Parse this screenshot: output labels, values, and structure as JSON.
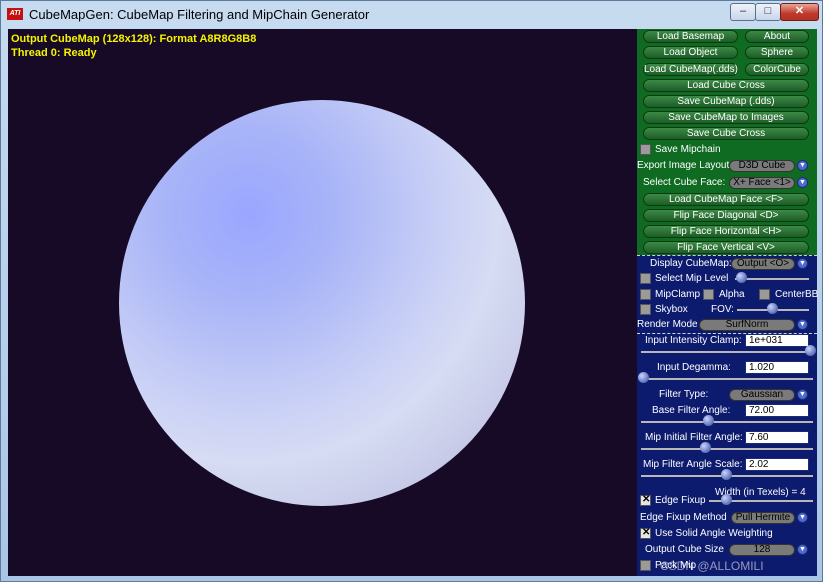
{
  "window": {
    "title": "CubeMapGen: CubeMap Filtering and MipChain Generator",
    "icon_text": "ATI",
    "min": "–",
    "max": "□",
    "close": "✕"
  },
  "viewport": {
    "line1": "Output CubeMap (128x128): Format A8R8G8B8",
    "line2": "Thread 0: Ready"
  },
  "buttons": {
    "load_basemap": "Load Basemap",
    "about": "About",
    "load_object": "Load Object",
    "sphere": "Sphere",
    "load_cubemap_dds": "Load CubeMap(.dds)",
    "color_cube": "ColorCube",
    "load_cube_cross": "Load Cube Cross",
    "save_cubemap_dds": "Save CubeMap (.dds)",
    "save_cubemap_images": "Save CubeMap to Images",
    "save_cube_cross": "Save Cube Cross",
    "load_cubemap_face": "Load CubeMap Face   <F>",
    "flip_diagonal": "Flip Face Diagonal   <D>",
    "flip_horizontal": "Flip Face Horizontal   <H>",
    "flip_vertical": "Flip Face Vertical   <V>"
  },
  "labels": {
    "save_mipchain": "Save Mipchain",
    "export_layout": "Export Image Layout:",
    "select_face": "Select Cube Face:",
    "display_cubemap": "Display CubeMap:",
    "select_mip": "Select Mip Level",
    "mipclamp": "MipClamp",
    "alpha": "Alpha",
    "centerbb": "CenterBB",
    "skybox": "Skybox",
    "fov": "FOV:",
    "render_mode": "Render Mode",
    "input_clamp": "Input Intensity Clamp:",
    "input_degamma": "Input Degamma:",
    "filter_type": "Filter Type:",
    "base_filter": "Base Filter Angle:",
    "mip_initial": "Mip Initial Filter Angle:",
    "mip_scale": "Mip Filter Angle Scale:",
    "width_texels": "Width (in Texels) = 4",
    "edge_fixup": "Edge Fixup",
    "edge_method": "Edge Fixup Method",
    "solid_angle": "Use Solid Angle Weighting",
    "output_size": "Output Cube Size",
    "pack_mip": "Pack Mip"
  },
  "values": {
    "export_layout": "D3D Cube",
    "select_face": "X+ Face <1>",
    "display_cubemap": "Output <O>",
    "render_mode": "SurfNorm",
    "input_clamp": "1e+031",
    "input_degamma": "1.020",
    "filter_type": "Gaussian",
    "base_filter": "72.00",
    "mip_initial": "7.60",
    "mip_scale": "2.02",
    "edge_method": "Pull Hermite",
    "output_size": "128"
  },
  "checkboxes": {
    "save_mipchain": false,
    "select_mip": false,
    "mipclamp": false,
    "alpha": false,
    "centerbb": false,
    "skybox": false,
    "edge_fixup": true,
    "solid_angle": true,
    "pack_mip": false
  },
  "watermark": "CSDN @ALLOMILI",
  "colors": {
    "viewport_bg": "#160a26",
    "panel_green": "#0f6b21",
    "panel_blue": "#0d1b6f",
    "status_text": "#f4f400"
  }
}
